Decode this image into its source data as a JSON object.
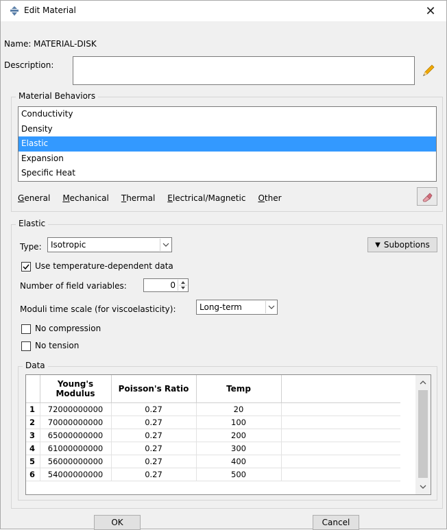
{
  "window": {
    "title": "Edit Material",
    "close_glyph": "✕",
    "icon": "material-icon"
  },
  "name": {
    "label": "Name:",
    "value": "MATERIAL-DISK"
  },
  "description": {
    "label": "Description:",
    "value": "",
    "edit_icon": "pencil-icon"
  },
  "behaviors": {
    "group_title": "Material Behaviors",
    "items": [
      "Conductivity",
      "Density",
      "Elastic",
      "Expansion",
      "Specific Heat"
    ],
    "selected": "Elastic",
    "menu": [
      {
        "label": "General",
        "mnemonic": "G",
        "rest": "eneral"
      },
      {
        "label": "Mechanical",
        "mnemonic": "M",
        "rest": "echanical"
      },
      {
        "label": "Thermal",
        "mnemonic": "T",
        "rest": "hermal"
      },
      {
        "label": "Electrical/Magnetic",
        "mnemonic": "E",
        "rest": "lectrical/Magnetic"
      },
      {
        "label": "Other",
        "mnemonic": "O",
        "rest": "ther"
      }
    ],
    "delete_icon": "eraser-icon"
  },
  "elastic": {
    "group_title": "Elastic",
    "type_label": "Type:",
    "type_value": "Isotropic",
    "suboptions_label": "Suboptions",
    "suboptions_glyph": "▼",
    "temp_dependent_label": "Use temperature-dependent data",
    "temp_dependent_checked": true,
    "field_vars_label": "Number of field variables:",
    "field_vars_value": "0",
    "moduli_label": "Moduli time scale (for viscoelasticity):",
    "moduli_value": "Long-term",
    "no_compression_label": "No compression",
    "no_compression_checked": false,
    "no_tension_label": "No tension",
    "no_tension_checked": false
  },
  "data": {
    "group_title": "Data",
    "columns": [
      "Young's Modulus",
      "Poisson's Ratio",
      "Temp"
    ],
    "rows": [
      {
        "n": "1",
        "young": "72000000000",
        "poisson": "0.27",
        "temp": "20"
      },
      {
        "n": "2",
        "young": "70000000000",
        "poisson": "0.27",
        "temp": "100"
      },
      {
        "n": "3",
        "young": "65000000000",
        "poisson": "0.27",
        "temp": "200"
      },
      {
        "n": "4",
        "young": "61000000000",
        "poisson": "0.27",
        "temp": "300"
      },
      {
        "n": "5",
        "young": "56000000000",
        "poisson": "0.27",
        "temp": "400"
      },
      {
        "n": "6",
        "young": "54000000000",
        "poisson": "0.27",
        "temp": "500"
      }
    ]
  },
  "buttons": {
    "ok": "OK",
    "cancel": "Cancel"
  },
  "colors": {
    "selection": "#3399ff",
    "window_bg": "#f0f0f0",
    "pencil": "#f2a900"
  }
}
